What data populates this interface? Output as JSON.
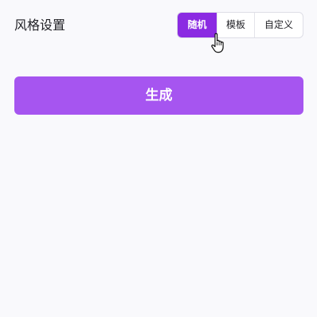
{
  "style_settings": {
    "title": "风格设置",
    "options": [
      "随机",
      "模板",
      "自定义"
    ],
    "selected": "随机"
  },
  "generate_button": {
    "label": "生成"
  },
  "colors": {
    "accent": "#8b2be2",
    "button": "#a655f0",
    "background": "#f9f9fc"
  },
  "cursor": "hand-pointer-icon"
}
